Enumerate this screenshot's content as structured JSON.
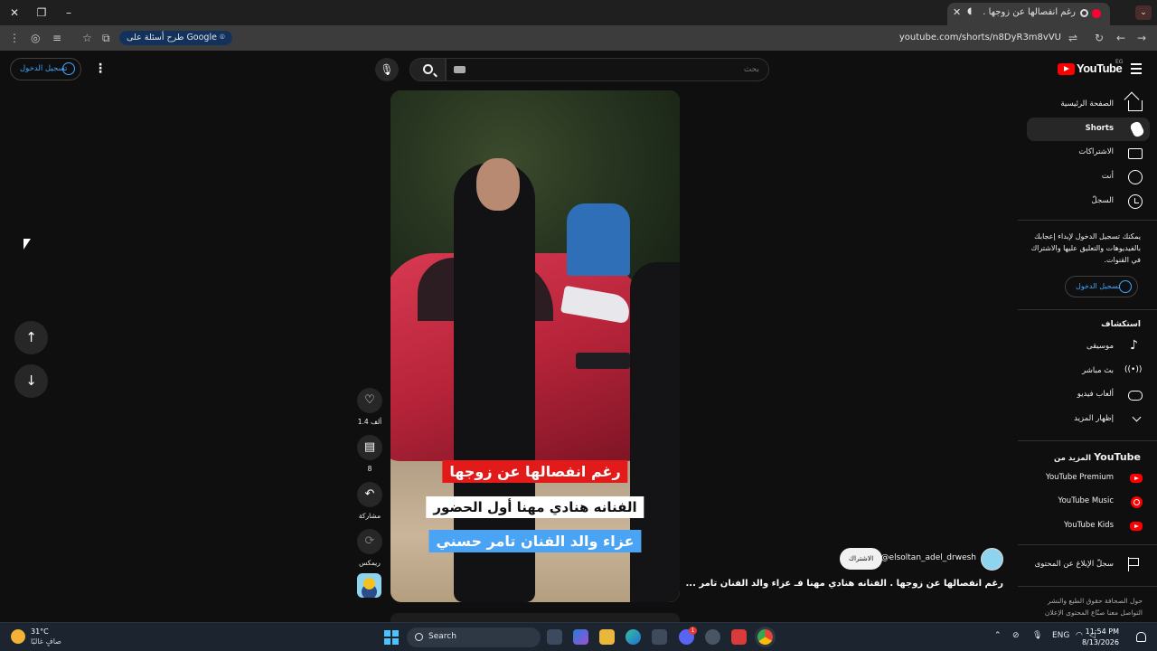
{
  "browser": {
    "tab_title": "رغم انفصالها عن زوجها . الفنا",
    "url": "youtube.com/shorts/n8DyR3m8vVU",
    "google_chip": "طرح أسئلة على Google"
  },
  "masthead": {
    "signin_label": "تسجيل الدخول",
    "search_placeholder": "بحث",
    "logo_text": "YouTube",
    "country_code": "EG"
  },
  "guide": {
    "items": [
      {
        "label": "الصفحة الرئيسية",
        "icon": "home-icon"
      },
      {
        "label": "Shorts",
        "icon": "shorts-icon",
        "active": true
      },
      {
        "label": "الاشتراكات",
        "icon": "subscriptions-icon"
      },
      {
        "label": "أنت",
        "icon": "you-icon"
      },
      {
        "label": "السجلّ",
        "icon": "history-icon"
      }
    ],
    "promo_text": "يمكنك تسجيل الدخول لإبداء إعجابك بالفيديوهات والتعليق عليها والاشتراك في القنوات.",
    "promo_signin": "تسجيل الدخول",
    "explore_heading": "استكشاف",
    "explore_items": [
      {
        "label": "موسيقى",
        "icon": "music-icon"
      },
      {
        "label": "بث مباشر",
        "icon": "live-icon"
      },
      {
        "label": "ألعاب فيديو",
        "icon": "gaming-icon"
      },
      {
        "label": "إظهار المزيد",
        "icon": "chevron-down-icon"
      }
    ],
    "more_heading_prefix": "المزيد من",
    "more_heading_brand": "YouTube",
    "more_items": [
      {
        "label": "YouTube Premium",
        "icon": "youtube-premium-icon"
      },
      {
        "label": "YouTube Music",
        "icon": "youtube-music-icon"
      },
      {
        "label": "YouTube Kids",
        "icon": "youtube-kids-icon"
      }
    ],
    "report_label": "سجلّ الإبلاغ عن المحتوى",
    "footer": "حول  الصحافة  حقوق الطبع والنشر  التواصل معنا  صنّاع المحتوى  الإعلان"
  },
  "short": {
    "captions": [
      "رغم انفصالها عن زوجها",
      "الفنانه هنادي مهنا أول الحضور",
      "عزاء والد الفنان تامر حسني"
    ],
    "likes": "1.4 ألف",
    "comments": "8",
    "share_label": "مشاركة",
    "remix_label": "ريمكس",
    "channel": "@elsoltan_adel_drwesh",
    "subscribe_label": "الاشتراك",
    "title": "رغم انفصالها عن زوجها . الفنانه هنادي مهنا فـ  عزاء والد الفنان تامر ..."
  },
  "taskbar": {
    "temperature": "31°C",
    "weather_desc": "صافٍ غالبًا",
    "search_label": "Search",
    "language": "ENG",
    "time": "11:54 PM",
    "date": "8/13/2026",
    "discord_badge": "1"
  },
  "colors": {
    "youtube_red": "#ff0000",
    "link_blue": "#3ea6ff",
    "caption_red": "#e21a1a",
    "caption_blue": "#4aa3f3"
  }
}
